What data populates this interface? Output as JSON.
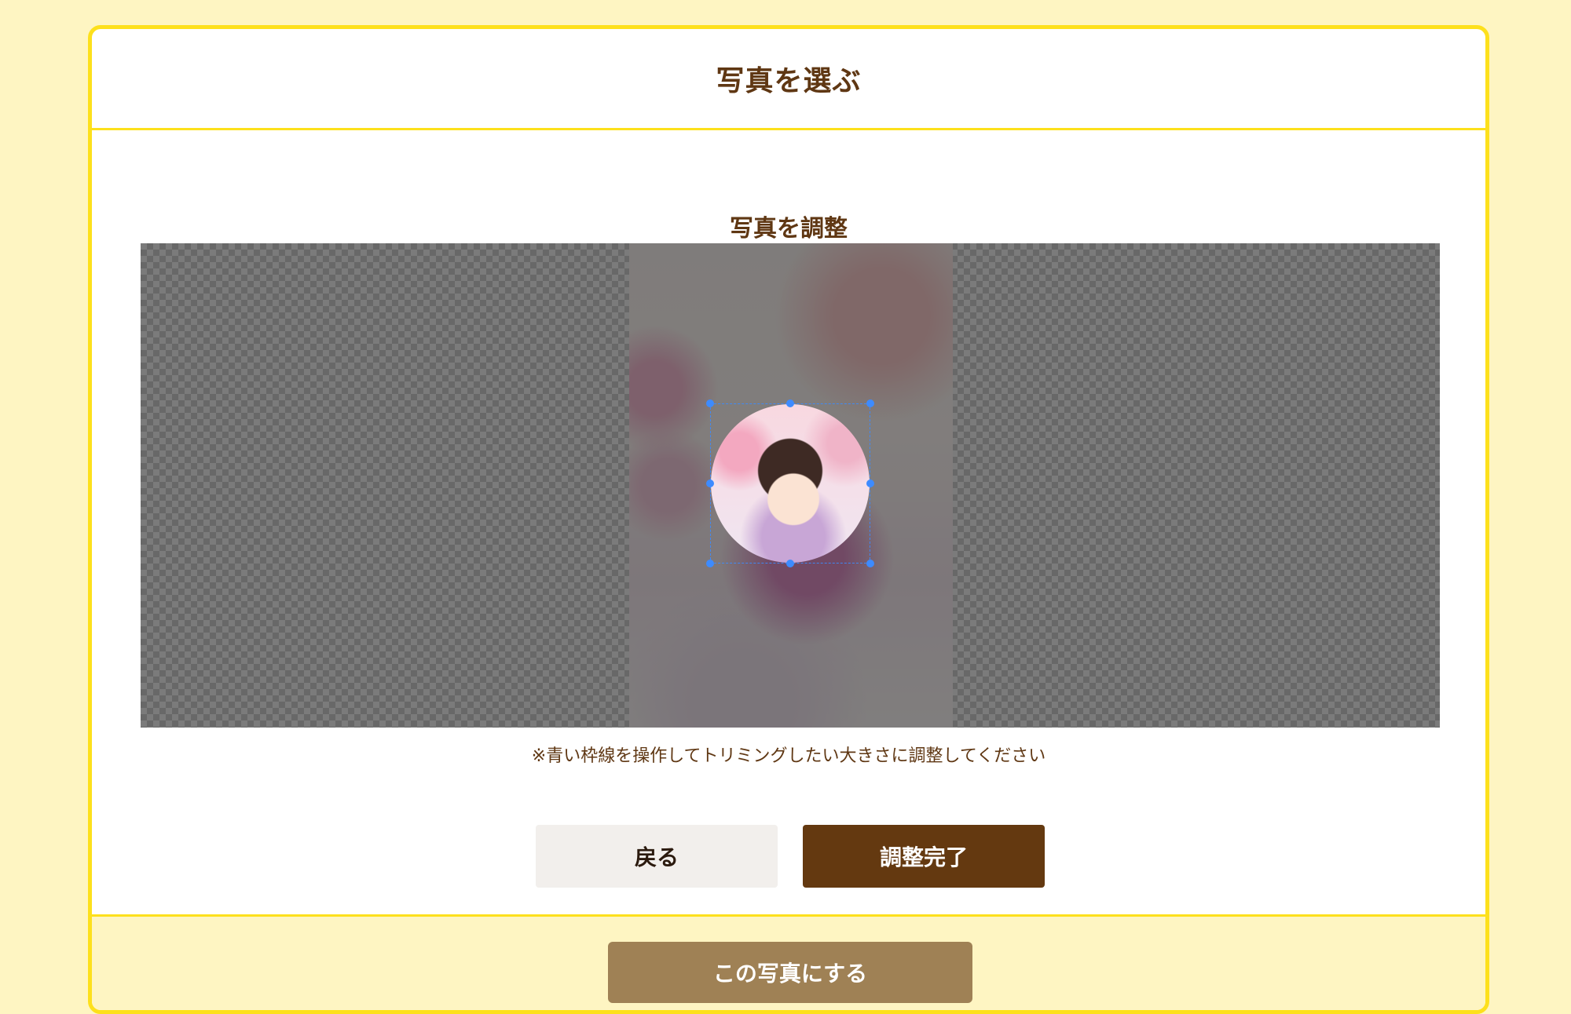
{
  "modal": {
    "title": "写真を選ぶ"
  },
  "editor": {
    "section_title": "写真を調整",
    "note": "※青い枠線を操作してトリミングしたい大きさに調整してください",
    "back_label": "戻る",
    "done_label": "調整完了"
  },
  "footer": {
    "select_label": "この写真にする"
  },
  "colors": {
    "accent": "#fde01c",
    "background": "#fef5c2",
    "brown": "#643910",
    "tan": "#9f8155"
  }
}
